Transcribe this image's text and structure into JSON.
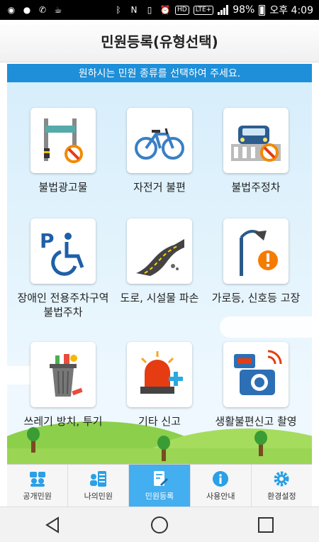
{
  "status_bar": {
    "battery": "98%",
    "time": "오후 4:09",
    "badges": [
      "HD",
      "LTE+"
    ]
  },
  "header": {
    "title": "민원등록(유형선택)"
  },
  "notice": {
    "text": "원하시는 민원 종류를 선택하여 주세요."
  },
  "categories": [
    {
      "label": "불법광고물",
      "icon": "illegal-poster-icon"
    },
    {
      "label": "자전거 불편",
      "icon": "bicycle-icon"
    },
    {
      "label": "불법주정차",
      "icon": "illegal-parking-icon"
    },
    {
      "label": "장애인 전용주차구역\n불법주차",
      "icon": "disabled-parking-icon"
    },
    {
      "label": "도로, 시설물 파손",
      "icon": "road-damage-icon"
    },
    {
      "label": "가로등, 신호등 고장",
      "icon": "streetlight-icon"
    },
    {
      "label": "쓰레기 방치, 투기",
      "icon": "trash-icon"
    },
    {
      "label": "기타 신고",
      "icon": "siren-icon"
    },
    {
      "label": "생활불편신고 촬영",
      "icon": "camera-icon"
    }
  ],
  "bottom_nav": [
    {
      "label": "공개민원",
      "icon": "public-complaint-icon",
      "active": false
    },
    {
      "label": "나의민원",
      "icon": "my-complaint-icon",
      "active": false
    },
    {
      "label": "민원등록",
      "icon": "register-complaint-icon",
      "active": true
    },
    {
      "label": "사용안내",
      "icon": "info-icon",
      "active": false
    },
    {
      "label": "환경설정",
      "icon": "gear-icon",
      "active": false
    }
  ],
  "colors": {
    "accent": "#1e8fd8",
    "active_tab": "#43aef0",
    "sky": "#d7eefb",
    "grass": "#8ccf4b"
  }
}
